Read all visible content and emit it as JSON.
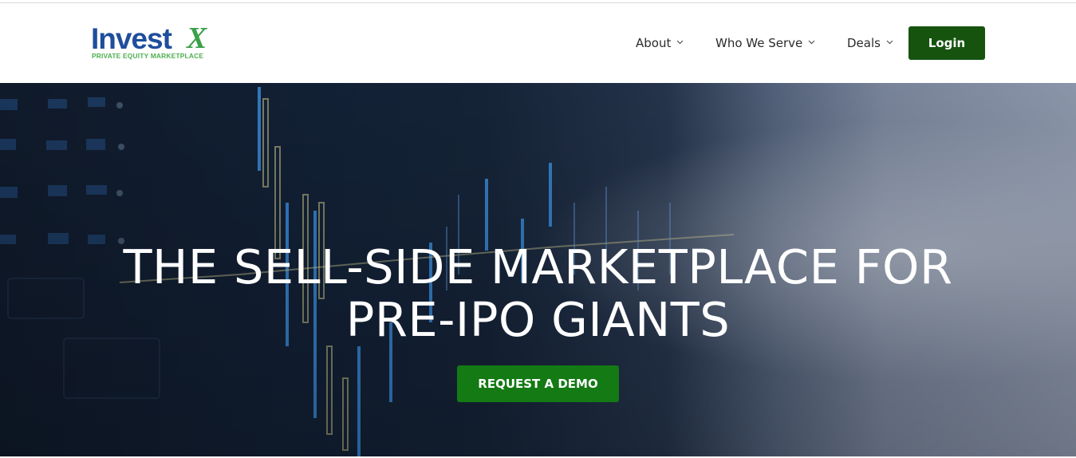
{
  "logo": {
    "word": "Invest",
    "mark": "X",
    "tagline": "PRIVATE EQUITY MARKETPLACE"
  },
  "nav": {
    "items": [
      {
        "label": "About",
        "icon": "chevron-down-icon"
      },
      {
        "label": "Who We Serve",
        "icon": "chevron-down-icon"
      },
      {
        "label": "Deals",
        "icon": "chevron-down-icon"
      }
    ],
    "login_label": "Login"
  },
  "hero": {
    "title_line1": "THE SELL-SIDE MARKETPLACE FOR",
    "title_line2": "PRE-IPO GIANTS",
    "cta_label": "REQUEST A DEMO"
  },
  "colors": {
    "brand_blue": "#1f4e9c",
    "brand_green": "#3aa04a",
    "login_button": "#15530f",
    "cta_button": "#147a14"
  }
}
